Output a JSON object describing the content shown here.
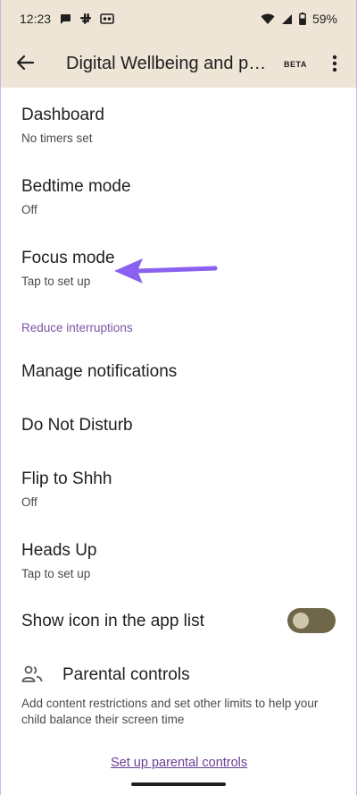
{
  "status_bar": {
    "time": "12:23",
    "battery": "59%",
    "icons": [
      "chat-bubble-icon",
      "slack-icon",
      "voicemail-icon",
      "wifi-icon",
      "cellular-signal-icon",
      "battery-icon"
    ]
  },
  "app_bar": {
    "title": "Digital Wellbeing and parental controls",
    "badge": "BETA",
    "icons": [
      "back-arrow-icon",
      "more-vert-icon"
    ]
  },
  "items": [
    {
      "title": "Dashboard",
      "subtitle": "No timers set"
    },
    {
      "title": "Bedtime mode",
      "subtitle": "Off"
    },
    {
      "title": "Focus mode",
      "subtitle": "Tap to set up"
    }
  ],
  "section_header": "Reduce interruptions",
  "interruption_items": [
    {
      "title": "Manage notifications"
    },
    {
      "title": "Do Not Disturb"
    },
    {
      "title": "Flip to Shhh",
      "subtitle": "Off"
    },
    {
      "title": "Heads Up",
      "subtitle": "Tap to set up"
    }
  ],
  "show_icon": {
    "label": "Show icon in the app list",
    "enabled": false
  },
  "parental": {
    "title": "Parental controls",
    "description": "Add content restrictions and set other limits to help your child balance their screen time",
    "link": "Set up parental controls"
  },
  "colors": {
    "app_bar_bg": "#efe5d6",
    "accent": "#7a54a6",
    "link": "#6a3f94",
    "annotation_arrow": "#8a60f0",
    "toggle_track": "#6f6748"
  }
}
